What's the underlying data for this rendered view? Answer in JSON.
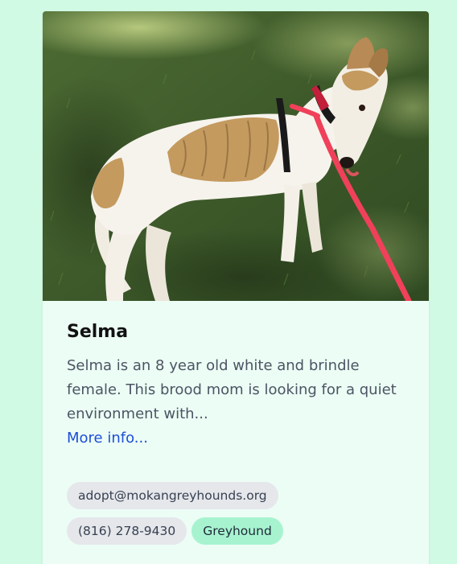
{
  "dog": {
    "name": "Selma",
    "photo_alt": "Selma",
    "description": "Selma is an 8 year old white and brindle female. This brood mom is looking for a quiet environment with...",
    "more_link": "More info..."
  },
  "tags": {
    "email": "adopt@mokangreyhounds.org",
    "phone": "(816) 278-9430",
    "breed": "Greyhound"
  },
  "colors": {
    "page_background": "#d1fae5",
    "card_background": "#ecfdf5",
    "link": "#1d4ed8",
    "neutral_tag": "#e5e7eb",
    "breed_tag": "#a7f3d0",
    "leash": "#f0405a"
  }
}
